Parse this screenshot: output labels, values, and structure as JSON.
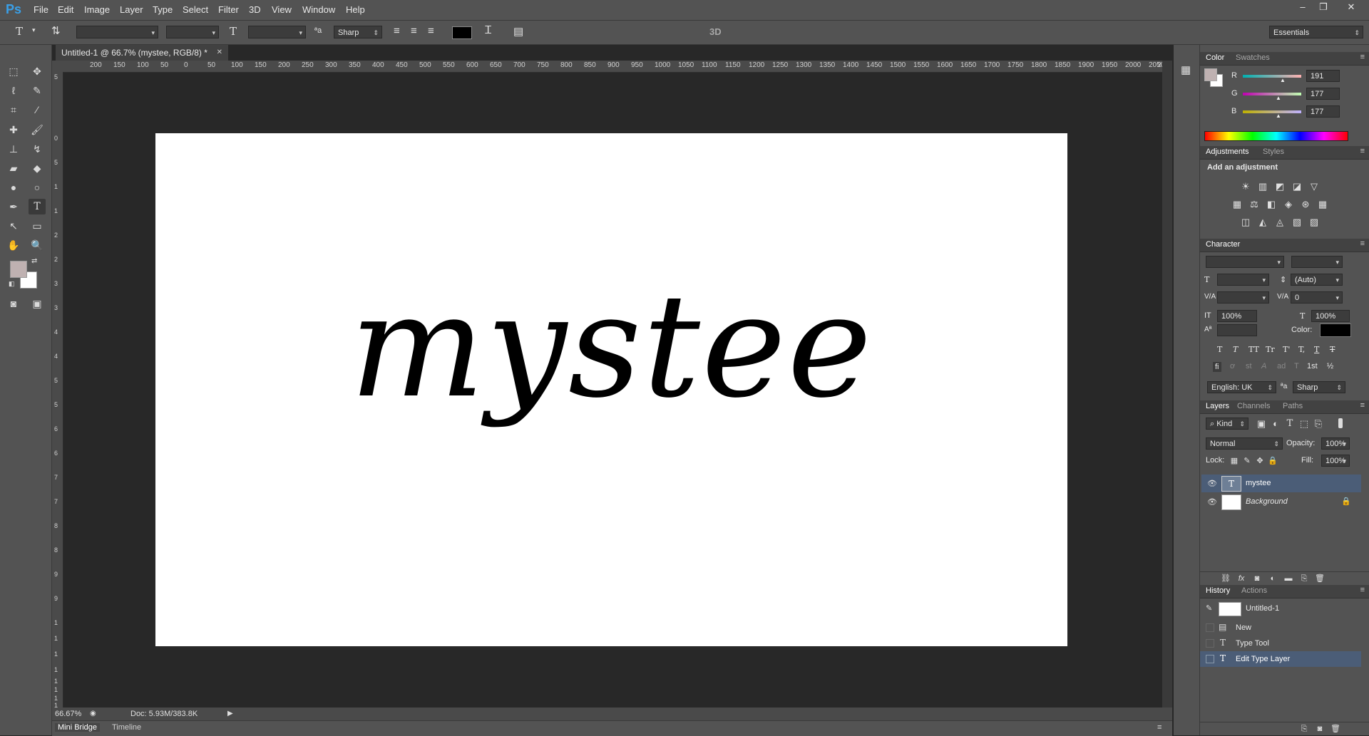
{
  "app": {
    "logo": "Ps",
    "menu": [
      "File",
      "Edit",
      "Image",
      "Layer",
      "Type",
      "Select",
      "Filter",
      "3D",
      "View",
      "Window",
      "Help"
    ],
    "window_controls": [
      "–",
      "❐",
      "✕"
    ]
  },
  "options_bar": {
    "tool_icon": "T",
    "antialias": "Sharp",
    "label_3d": "3D",
    "workspace": "Essentials"
  },
  "document": {
    "tab_title": "Untitled-1 @ 66.7% (mystee, RGB/8) *",
    "tab_close": "✕",
    "canvas_text": "mystee",
    "ruler_top": [
      "200",
      "150",
      "100",
      "50",
      "0",
      "50",
      "100",
      "150",
      "200",
      "250",
      "300",
      "350",
      "400",
      "450",
      "500",
      "550",
      "600",
      "650",
      "700",
      "750",
      "800",
      "850",
      "900",
      "950",
      "1000",
      "1050",
      "1100",
      "1150",
      "1200",
      "1250",
      "1300",
      "1350",
      "1400",
      "1450",
      "1500",
      "1550",
      "1600",
      "1650",
      "1700",
      "1750",
      "1800",
      "1850",
      "1900",
      "1950",
      "2000",
      "2050",
      "2"
    ],
    "ruler_left": [
      "5",
      "0",
      "5",
      "1",
      "1",
      "2",
      "2",
      "3",
      "3",
      "4",
      "4",
      "5",
      "5",
      "6",
      "6",
      "7",
      "7",
      "8",
      "8",
      "9",
      "9",
      "1",
      "1",
      "1",
      "1",
      "1",
      "1",
      "1",
      "1"
    ],
    "zoom": "66.67%",
    "doc_info": "Doc: 5.93M/383.8K"
  },
  "bottom_tabs": [
    "Mini Bridge",
    "Timeline"
  ],
  "color_panel": {
    "tabs": [
      "Color",
      "Swatches"
    ],
    "channels": [
      {
        "label": "R",
        "value": "191"
      },
      {
        "label": "G",
        "value": "177"
      },
      {
        "label": "B",
        "value": "177"
      }
    ],
    "foreground": "#bfb1b1"
  },
  "adjustments_panel": {
    "tabs": [
      "Adjustments",
      "Styles"
    ],
    "heading": "Add an adjustment"
  },
  "character_panel": {
    "title": "Character",
    "leading": "(Auto)",
    "tracking": "0",
    "vscale": "100%",
    "hscale": "100%",
    "color_label": "Color:",
    "language": "English: UK",
    "antialias": "Sharp",
    "type_styles": [
      "T",
      "T",
      "TT",
      "Tr",
      "T'",
      "T,",
      "T",
      "T"
    ],
    "opentype": [
      "fi",
      "ơ",
      "st",
      "A",
      "ad",
      "T",
      "1st",
      "½"
    ]
  },
  "layers_panel": {
    "tabs": [
      "Layers",
      "Channels",
      "Paths"
    ],
    "filter": "Kind",
    "blend_mode": "Normal",
    "opacity_label": "Opacity:",
    "opacity": "100%",
    "lock_label": "Lock:",
    "fill_label": "Fill:",
    "fill": "100%",
    "layers": [
      {
        "name": "mystee",
        "type": "text",
        "selected": true
      },
      {
        "name": "Background",
        "type": "background",
        "selected": false
      }
    ]
  },
  "history_panel": {
    "tabs": [
      "History",
      "Actions"
    ],
    "snapshot": "Untitled-1",
    "items": [
      {
        "label": "New",
        "icon": "document-icon"
      },
      {
        "label": "Type Tool",
        "icon": "type-icon"
      },
      {
        "label": "Edit Type Layer",
        "icon": "type-icon"
      }
    ]
  },
  "colors": {
    "accent": "#3aa0e8",
    "selection": "#4b5d77"
  }
}
